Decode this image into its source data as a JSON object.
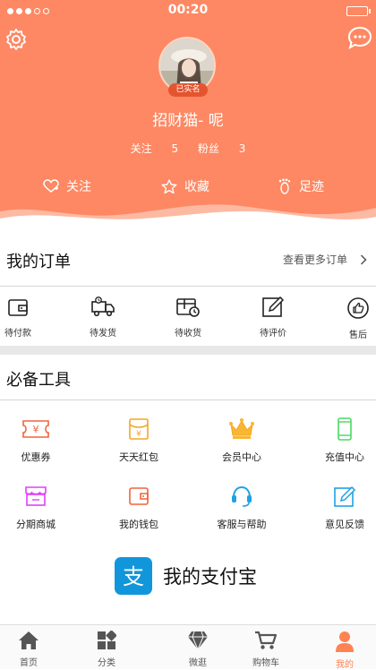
{
  "status_bar": {
    "time": "00:20"
  },
  "profile": {
    "verified_badge": "已实名",
    "username": "招财猫- 呢",
    "following_label": "关注",
    "following_count": "5",
    "followers_label": "粉丝",
    "followers_count": "3"
  },
  "header_actions": [
    {
      "label": "关注",
      "icon": "follow-icon"
    },
    {
      "label": "收藏",
      "icon": "star-icon"
    },
    {
      "label": "足迹",
      "icon": "footprint-icon"
    }
  ],
  "orders": {
    "title": "我的订单",
    "more_label": "查看更多订单",
    "items": [
      {
        "label": "待付款",
        "icon": "wallet-icon"
      },
      {
        "label": "待发货",
        "icon": "truck-icon"
      },
      {
        "label": "待收货",
        "icon": "package-icon"
      },
      {
        "label": "待评价",
        "icon": "edit-icon"
      },
      {
        "label": "售后",
        "icon": "thumb-icon"
      }
    ]
  },
  "tools": {
    "title": "必备工具",
    "items": [
      {
        "label": "优惠券",
        "icon": "coupon-icon"
      },
      {
        "label": "天天红包",
        "icon": "red-packet-icon"
      },
      {
        "label": "会员中心",
        "icon": "crown-icon"
      },
      {
        "label": "充值中心",
        "icon": "phone-icon"
      },
      {
        "label": "分期商城",
        "icon": "shop-icon"
      },
      {
        "label": "我的钱包",
        "icon": "wallet-icon"
      },
      {
        "label": "客服与帮助",
        "icon": "headset-icon"
      },
      {
        "label": "意见反馈",
        "icon": "feedback-icon"
      }
    ]
  },
  "alipay": {
    "label": "我的支付宝",
    "logo_text": "支"
  },
  "tabbar": {
    "items": [
      {
        "label": "首页",
        "icon": "home-icon"
      },
      {
        "label": "分类",
        "icon": "category-icon"
      },
      {
        "label": "微逛",
        "icon": "diamond-icon"
      },
      {
        "label": "购物车",
        "icon": "cart-icon"
      },
      {
        "label": "我的",
        "icon": "person-icon",
        "active": true
      }
    ]
  },
  "colors": {
    "header": "#fd8863",
    "accent": "#ff8352",
    "alipay": "#1296db"
  }
}
